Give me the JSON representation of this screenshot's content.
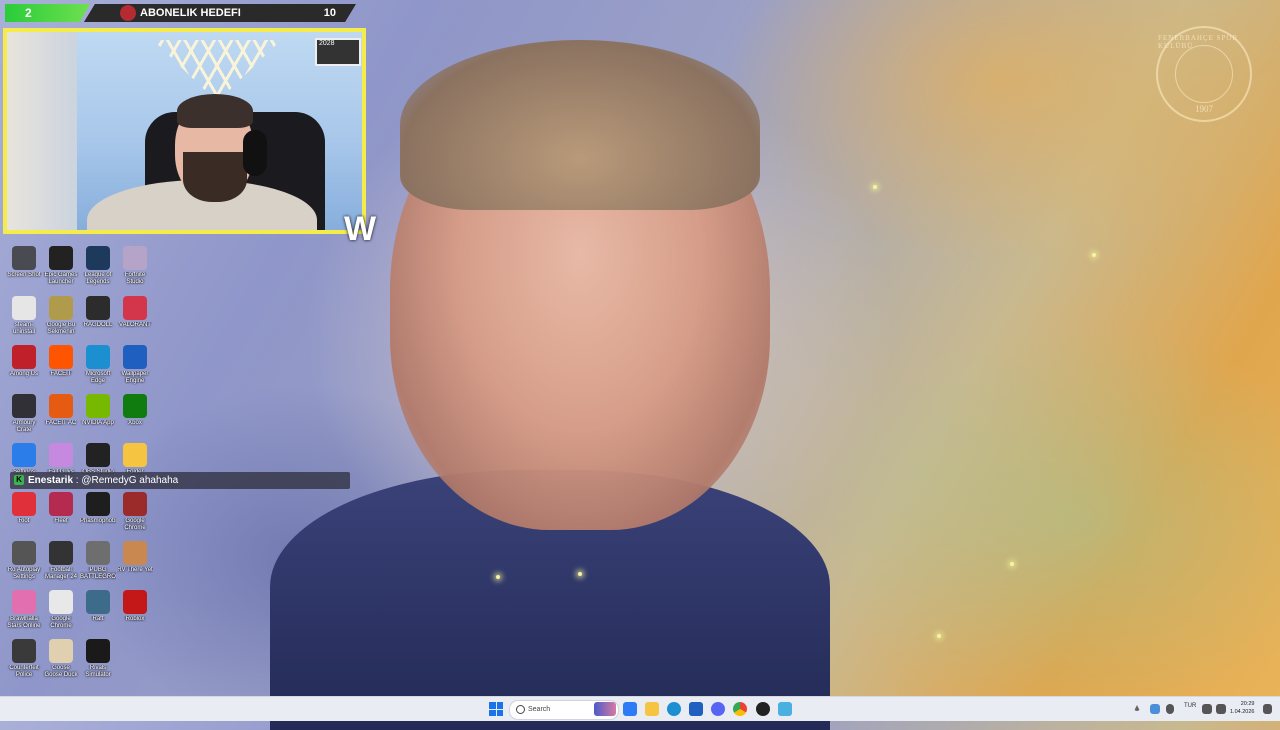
{
  "overlay": {
    "follower_count": "2",
    "goal_label": "ABONELIK HEDEFI",
    "goal_value": "10",
    "cam_date": "2028"
  },
  "chat": {
    "user": "Enestarik",
    "message": " : @RemedyG ahahaha"
  },
  "watermark": {
    "club_text": "FENERBAHÇE SPOR KULÜBÜ",
    "year": "1907"
  },
  "desktop_icons": [
    {
      "label": "Screen Shot",
      "color": "#4a4a52"
    },
    {
      "label": "Epic Games Launcher",
      "color": "#222"
    },
    {
      "label": "League of Legends",
      "color": "#1d3a5c"
    },
    {
      "label": "Fortnite Studio",
      "color": "#b6a4c8"
    },
    {
      "label": "steam-uninstall",
      "color": "#e6e6e6"
    },
    {
      "label": "Google Bu Sekmenin",
      "color": "#b09a4c"
    },
    {
      "label": "RAGDOLL",
      "color": "#2c2c2c"
    },
    {
      "label": "VALORANT",
      "color": "#d3364a"
    },
    {
      "label": "Among Us",
      "color": "#c0202a"
    },
    {
      "label": "FACEIT",
      "color": "#ff5500"
    },
    {
      "label": "Microsoft Edge",
      "color": "#1b8fd0"
    },
    {
      "label": "Wallpaper Engine",
      "color": "#1f5fbf"
    },
    {
      "label": "Armoury Crate",
      "color": "#303036"
    },
    {
      "label": "FACEIT AC",
      "color": "#e55b12"
    },
    {
      "label": "NVIDIA App",
      "color": "#76b900"
    },
    {
      "label": "Xbox",
      "color": "#107c10"
    },
    {
      "label": "Settings",
      "color": "#2b7de9"
    },
    {
      "label": "Fall Guys",
      "color": "#c58ae0"
    },
    {
      "label": "OBS Studio",
      "color": "#222"
    },
    {
      "label": "Folder",
      "color": "#f5c542"
    },
    {
      "label": "Riot",
      "color": "#e0303a"
    },
    {
      "label": "Fleet",
      "color": "#b52b50"
    },
    {
      "label": "Phasmophobia",
      "color": "#1e1e1e"
    },
    {
      "label": "Google Chrome",
      "color": "#9b2b2b"
    },
    {
      "label": "Ro Autoplay Settings",
      "color": "#555"
    },
    {
      "label": "Football Manager 24",
      "color": "#333"
    },
    {
      "label": "PUBG BATTLEGROUNDS",
      "color": "#6e6e6e"
    },
    {
      "label": "RV There Yet",
      "color": "#c9884f"
    },
    {
      "label": "Brawlhalla Stars Online",
      "color": "#e26fb0"
    },
    {
      "label": "Google Chrome",
      "color": "#e8e8e8"
    },
    {
      "label": "Raft",
      "color": "#3d6b8a"
    },
    {
      "label": "Roblox",
      "color": "#c41818"
    },
    {
      "label": "Counterfeit Police",
      "color": "#3a3a3a"
    },
    {
      "label": "Goose Goose Duck",
      "color": "#e0d0b0"
    },
    {
      "label": "Rivals Simulator",
      "color": "#1a1a1a"
    }
  ],
  "taskbar": {
    "search_placeholder": "Search",
    "language": "TUR",
    "time": "20:29",
    "date": "1.04.2026"
  }
}
